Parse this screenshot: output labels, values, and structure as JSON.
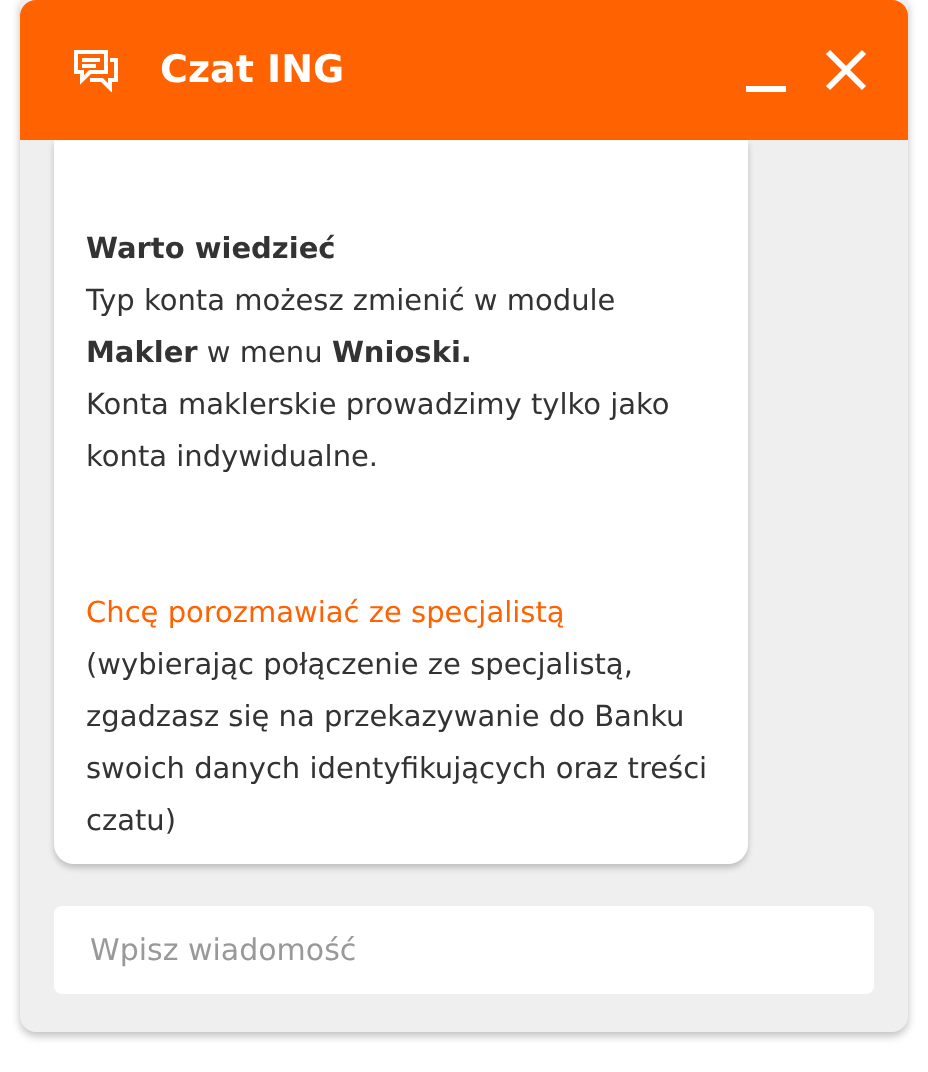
{
  "window": {
    "title": "Czat ING"
  },
  "message": {
    "heading": "Warto wiedzieć",
    "lines": [
      "Typ konta możesz zmienić w module **Makler** w menu **Wnioski.**",
      "Konta maklerskie prowadzimy tylko jako konta indywidualne."
    ],
    "link": "Chcę porozmawiać ze specjalistą",
    "note": "(wybierając połączenie ze specjalistą, zgadzasz się na przekazywanie do Banku swoich danych identyfikujących oraz treści czatu)"
  },
  "input": {
    "placeholder": "Wpisz wiadomość"
  }
}
